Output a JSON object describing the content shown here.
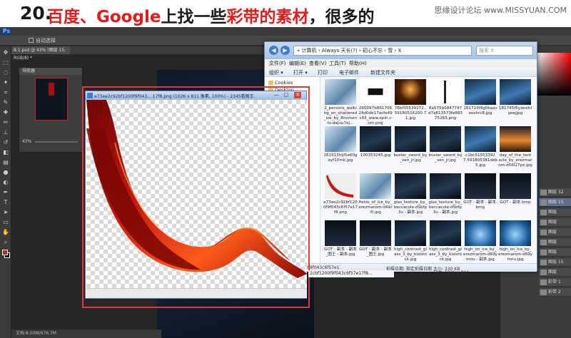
{
  "heading": {
    "number": "20.",
    "part1": "百度、Google",
    "part2": "上找一些",
    "part3": "彩带的素材",
    "part4": "，很多的",
    "site": "思缘设计论坛 www.MISSYUAN.COM"
  },
  "photoshop": {
    "logo": "Ps",
    "document_tab": "8.1.psd @ 43% (图层 15, RGB/8) *",
    "navigator_title": "导航器",
    "zoom": "43%",
    "status": "文档:8.00M/676.7M",
    "auto_select_label": "自动选择",
    "layers": [
      "图层 32",
      "图层 15",
      "图层",
      "图层",
      "图层",
      "图层",
      "图层",
      "图层 15",
      "图层",
      "彩带 1",
      "彩带 2"
    ],
    "colors": {
      "foreground": "#c8261d",
      "background": "#111111"
    }
  },
  "explorer": {
    "address": "« 计算机 › Always 天长(?) › 初心不忘 › 雪 › X",
    "search_placeholder": "搜索 X",
    "menu": [
      "文件(F)",
      "编辑(E)",
      "查看(V)",
      "工具(T)",
      "帮助(H)"
    ],
    "commands": [
      "组织 ▾",
      "打开 ▾",
      "打印",
      "电子邮件",
      "新建文件夹"
    ],
    "nav": [
      "Cookies",
      "Desktop"
    ],
    "files": [
      {
        "name": "2_persons_walking_on_shattered_ice_by_8monents-daJuu7ej...",
        "thumb": "ice"
      },
      {
        "name": "260097b86170624d0de17acfe49c93_www.epin.com.png",
        "thumb": "text"
      },
      {
        "name": "76bf35539272..59180516200 71.jpg",
        "thumb": "candle"
      },
      {
        "name": "8a575b0847747d7a613573fe88375283.png",
        "thumb": "sword"
      },
      {
        "name": "181723f4g0kaavooxhrc8.jpg",
        "thumb": "blue"
      },
      {
        "name": "181745f5yzesihigeejjpg",
        "thumb": "blue"
      },
      {
        "name": "181913hljl5e60gayf10mk.jpg",
        "thumb": "ice"
      },
      {
        "name": "100353245.jpg",
        "thumb": "dark"
      },
      {
        "name": "buster_sword_by_ven_jr.jpg",
        "thumb": "dark"
      },
      {
        "name": "buster_sword_by_ven_jr.jpg",
        "thumb": "dark"
      },
      {
        "name": "c1bc51553392 7.591805381deb5.jpg",
        "thumb": "blue"
      },
      {
        "name": "day_of_the_tentacle_by_erezmarom-d56l27px.jpg",
        "thumb": "orange"
      },
      {
        "name": "e73ee2c92bf1200f9f043c6f57e17f8.png",
        "thumb": "ribbon"
      },
      {
        "name": "fields_of_ice_by_erezmarom-d4ikll0.jpg",
        "thumb": "ice"
      },
      {
        "name": "glas_texture_by_beccacole-d5bfp3u - 副本.jpg",
        "thumb": "dark"
      },
      {
        "name": "glas_texture_by_beccacole-d5bfp3u - 副本.jpg",
        "thumb": "dark"
      },
      {
        "name": "GOT - 副本 - 副本.bmp",
        "thumb": "got"
      },
      {
        "name": "GOT - 副本.bmp",
        "thumb": "got"
      },
      {
        "name": "GOT - 副本 - 副本_图王 - 副本.jpg",
        "thumb": "got"
      },
      {
        "name": "GOT - 副本 - 副本_图王.jpg",
        "thumb": "got"
      },
      {
        "name": "high_contrast_glass_3_by_kislsto ck.jpg",
        "thumb": "dark"
      },
      {
        "name": "high_contrast_glass_3_by_kislsto ck.jpg",
        "thumb": "dark"
      },
      {
        "name": "high_on_ice_by_erezmarom-d69ymnu - 副本.jpg",
        "thumb": "ice2"
      },
      {
        "name": "high_on_ice_by_erezmarom-d69ymnu.jpg",
        "thumb": "ice2"
      }
    ],
    "status_name": "e73ee2c92bf1200f9f043c6f57e17f8...",
    "status_date_label": "拍摄日期: 指定拍摄日期",
    "status_size": "大小: 330 KB",
    "status_dimensions": "尺寸: 1026 x 811"
  },
  "viewer": {
    "title": "e73ee2c92bf1200f9f043... 17f8.png (1026 x 811 像素, 100%) - 2345看图王",
    "filename_strip": "2cbf1200f9f043c6f57e17f8...",
    "min": "—",
    "max": "□",
    "close": "✕"
  }
}
